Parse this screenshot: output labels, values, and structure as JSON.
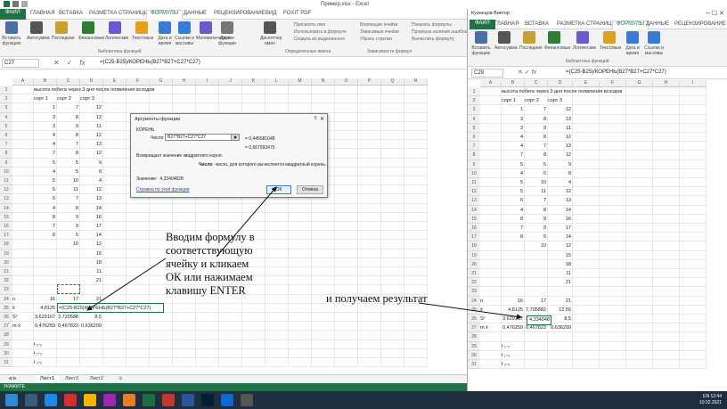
{
  "window": {
    "title": "Пример.xlsx - Excel"
  },
  "tabs": [
    "ФАЙЛ",
    "ГЛАВНАЯ",
    "ВСТАВКА",
    "РАЗМЕТКА СТРАНИЦЫ",
    "ФОРМУЛЫ",
    "ДАННЫЕ",
    "РЕЦЕНЗИРОВАНИЕ",
    "ВИД",
    "FOXIT PDF"
  ],
  "ribbon": {
    "buttons": [
      "Вставить функцию",
      "Автосумма",
      "Последние",
      "Финансовые",
      "Логические",
      "Текстовые",
      "Дата и время",
      "Ссылки и массивы",
      "Математические",
      "Другие функции",
      "Диспетчер имен"
    ],
    "names_items": [
      "Присвоить имя",
      "Использовать в формуле",
      "Создать из выделенного"
    ],
    "deps_items": [
      "Влияющие ячейки",
      "Зависимые ячейки",
      "Убрать стрелки"
    ],
    "audit_items": [
      "Показать формулы",
      "Проверка наличия ошибок",
      "Вычислить формулу"
    ],
    "groups": [
      "Библиотека функций",
      "Определенные имена",
      "Зависимости формул"
    ],
    "user": "Кузнецов Виктор"
  },
  "formula_bar": {
    "cell": "C27",
    "formula": "=(C25-B25)/КОРЕНЬ(B27*B27+C27*C27)"
  },
  "columns": [
    "A",
    "B",
    "C",
    "D",
    "E",
    "F",
    "G",
    "H",
    "I",
    "J",
    "K",
    "L",
    "M",
    "N",
    "O",
    "P",
    "Q",
    "R"
  ],
  "sheet": {
    "title_row": "высота побега через 3 дня после появления всходов",
    "headers": [
      "сорт 1",
      "сорт 2",
      "сорт 3"
    ],
    "rows": [
      [
        "1",
        "7",
        "12"
      ],
      [
        "3",
        "8",
        "13"
      ],
      [
        "3",
        "9",
        "11"
      ],
      [
        "4",
        "8",
        "12"
      ],
      [
        "4",
        "7",
        "13"
      ],
      [
        "7",
        "8",
        "12"
      ],
      [
        "5",
        "5",
        "9"
      ],
      [
        "4",
        "5",
        "8"
      ],
      [
        "5",
        "10",
        "4"
      ],
      [
        "5",
        "11",
        "12"
      ],
      [
        "6",
        "7",
        "13"
      ],
      [
        "4",
        "8",
        "14"
      ],
      [
        "8",
        "9",
        "16"
      ],
      [
        "7",
        "9",
        "17"
      ],
      [
        "8",
        "5",
        "14"
      ],
      [
        "",
        "10",
        "12"
      ],
      [
        "",
        "",
        "15"
      ],
      [
        "",
        "",
        "18"
      ],
      [
        "",
        "",
        "11"
      ],
      [
        "",
        "",
        "21"
      ]
    ],
    "stats": [
      {
        "label": "n",
        "b": "16",
        "c": "17",
        "d": "21"
      },
      {
        "label": "x̄",
        "b": "4,8125",
        "c": "7,705882",
        "d": "12,55"
      },
      {
        "label": "S²",
        "b": "3,629167",
        "c": "3,720588",
        "d": "8,5"
      },
      {
        "label": "m x̄",
        "b": "0,476259",
        "c": "0,467823",
        "d": "0,636209"
      }
    ],
    "t_labels": [
      "t ₁-₂",
      "t ₁-₃",
      "t ₂-₃"
    ],
    "edit_formula": "=(C25-B25)/КОРЕНЬ(B27*B27+C27*C27)",
    "result_value": "4,334048"
  },
  "dialog": {
    "title": "Аргументы функции",
    "function": "КОРЕНЬ",
    "arg_label": "Число",
    "arg_value": "B27*B27+C27*C27",
    "arg_eval": "= 0,445681048",
    "result_eq": "= 0,667593475",
    "description": "Возвращает значение квадратного корня.",
    "arg_desc_label": "Число",
    "arg_desc": "число, для которого вычисляется квадратный корень.",
    "value_label": "Значение:",
    "value": "4,33404828",
    "help": "Справка по этой функции",
    "ok": "ОК",
    "cancel": "Отмена"
  },
  "annotations": {
    "left": "Вводим формулу в соответствующую ячейку и кликаем ОК или нажимаем клавишу ENTER",
    "right": "и получаем результат"
  },
  "sheet_tabs": [
    "Лист1",
    "Лист3",
    "Лист2"
  ],
  "status": "УКАЖИТЕ",
  "right_window": {
    "cell": "C29",
    "formula": "=(C25-B25)/КОРЕНЬ(B27*B27+C27*C27)",
    "group": "Библиотека функций"
  },
  "tray": {
    "lang": "EN",
    "time": "12:44",
    "date": "10.02.2021"
  }
}
